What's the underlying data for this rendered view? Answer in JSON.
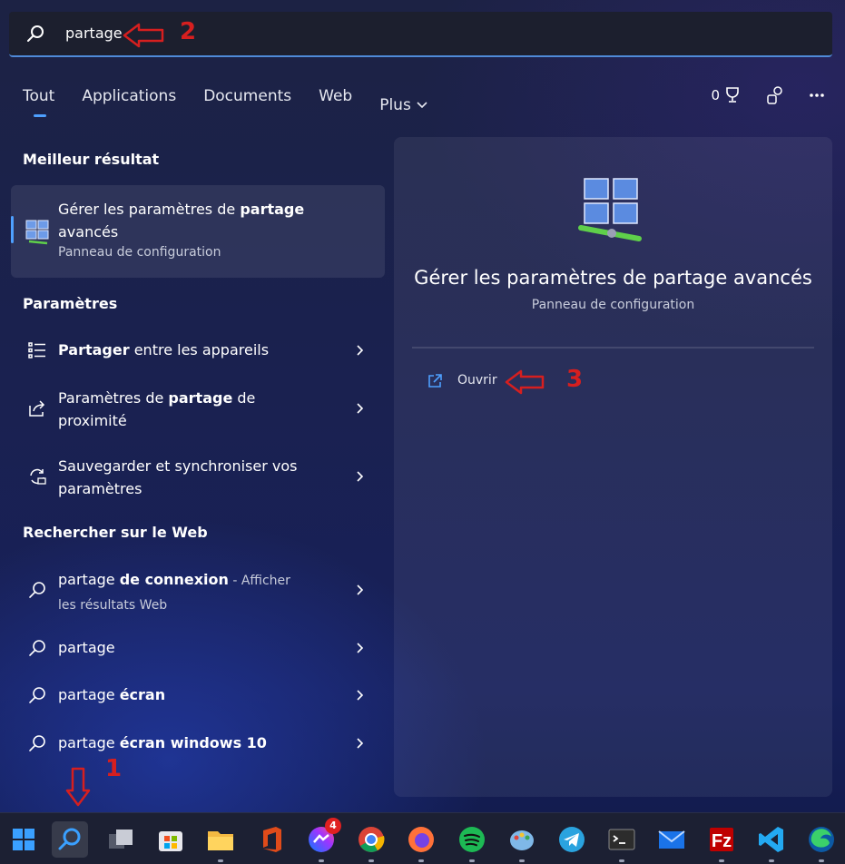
{
  "search": {
    "value": "partage"
  },
  "annotations": {
    "one": "1",
    "two": "2",
    "three": "3"
  },
  "tabs": [
    {
      "label": "Tout",
      "active": true
    },
    {
      "label": "Applications"
    },
    {
      "label": "Documents"
    },
    {
      "label": "Web"
    },
    {
      "label": "Plus"
    }
  ],
  "top_right": {
    "points": "0"
  },
  "best": {
    "heading": "Meilleur résultat",
    "title_prefix": "Gérer les paramètres de ",
    "title_bold": "partage",
    "title_suffix": " avancés",
    "subtitle": "Panneau de configuration"
  },
  "settings": {
    "heading": "Paramètres",
    "items": [
      {
        "bold": "Partager",
        "rest": " entre les appareils"
      },
      {
        "pre": "Paramètres de ",
        "bold": "partage",
        "rest": " de proximité"
      },
      {
        "pre": "Sauvegarder et synchroniser vos paramètres"
      }
    ]
  },
  "web": {
    "heading": "Rechercher sur le Web",
    "items": [
      {
        "pre": "partage ",
        "bold": "de connexion",
        "muted": " - Afficher les résultats Web"
      },
      {
        "pre": "partage"
      },
      {
        "pre": "partage ",
        "bold": "écran"
      },
      {
        "pre": "partage ",
        "bold": "écran windows 10"
      }
    ]
  },
  "panel": {
    "title": "Gérer les paramètres de partage avancés",
    "subtitle": "Panneau de configuration",
    "action": "Ouvrir"
  },
  "taskbar": {
    "apps": [
      "start-icon",
      "search-icon",
      "task-view-icon",
      "store-icon",
      "file-explorer-icon",
      "office-icon",
      "messenger-icon",
      "chrome-icon",
      "firefox-icon",
      "spotify-icon",
      "paint-icon",
      "telegram-icon",
      "terminal-icon",
      "mail-icon",
      "filezilla-icon",
      "vscode-icon",
      "edge-icon"
    ],
    "messenger_badge": "4"
  },
  "colors": {
    "accent": "#4ea0ff",
    "annotation": "#d61f1f"
  }
}
